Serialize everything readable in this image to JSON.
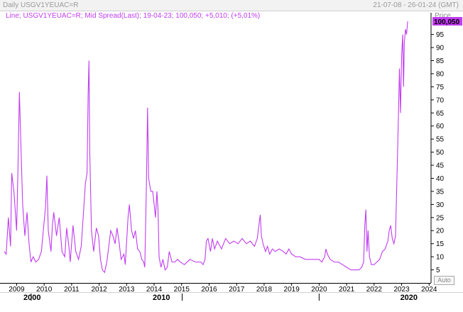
{
  "header": {
    "left_label": "Daily USGV1YEUAC=R",
    "right_label": "21-07-08 - 26-01-24 (GMT)",
    "price_label": "Price"
  },
  "legend": {
    "prefix": "Line; USGV1YEUAC=R; Mid Spread(Last); 19-04-23; 100,050; +5,010; (+5,01%)",
    "text": "Line; USGV1YEUAC=R; Mid Spread(Last); 19-04-23; 100,050; +5,010; (+5,01%)"
  },
  "auto_button": {
    "label": "Auto"
  },
  "last_value_badge": "100,050",
  "colors": {
    "series": "#c03cf0",
    "legend_text": "#2a2aa8",
    "badge_bg": "#c03cf0"
  },
  "chart_data": {
    "type": "line",
    "xlabel": "",
    "ylabel": "Price",
    "ylim": [
      0,
      100.05
    ],
    "xlim": [
      2008.55,
      2024.07
    ],
    "year_ticks": [
      "2009",
      "2010",
      "2011",
      "2012",
      "2013",
      "2014",
      "2015",
      "2016",
      "2017",
      "2018",
      "2019",
      "2020",
      "2021",
      "2022",
      "2023",
      "2024"
    ],
    "decade_ticks": [
      "2000",
      "2010",
      "2020"
    ],
    "y_ticks": [
      "5",
      "10",
      "15",
      "20",
      "25",
      "30",
      "35",
      "40",
      "45",
      "50",
      "55",
      "60",
      "65",
      "70",
      "75",
      "80",
      "85",
      "90",
      "95"
    ],
    "series": [
      {
        "points": [
          [
            2008.55,
            12
          ],
          [
            2008.62,
            11
          ],
          [
            2008.7,
            25
          ],
          [
            2008.78,
            14
          ],
          [
            2008.82,
            42
          ],
          [
            2008.9,
            35
          ],
          [
            2009.0,
            20
          ],
          [
            2009.05,
            45
          ],
          [
            2009.1,
            73
          ],
          [
            2009.15,
            55
          ],
          [
            2009.22,
            30
          ],
          [
            2009.3,
            18
          ],
          [
            2009.38,
            27
          ],
          [
            2009.45,
            15
          ],
          [
            2009.52,
            8
          ],
          [
            2009.6,
            10
          ],
          [
            2009.7,
            8
          ],
          [
            2009.8,
            9
          ],
          [
            2009.9,
            12
          ],
          [
            2009.96,
            19
          ],
          [
            2010.05,
            29
          ],
          [
            2010.1,
            41
          ],
          [
            2010.15,
            20
          ],
          [
            2010.25,
            12
          ],
          [
            2010.3,
            22
          ],
          [
            2010.35,
            27
          ],
          [
            2010.45,
            18
          ],
          [
            2010.55,
            25
          ],
          [
            2010.65,
            12
          ],
          [
            2010.75,
            10
          ],
          [
            2010.82,
            21
          ],
          [
            2010.9,
            14
          ],
          [
            2010.95,
            8
          ],
          [
            2011.05,
            22
          ],
          [
            2011.15,
            12
          ],
          [
            2011.25,
            9
          ],
          [
            2011.35,
            14
          ],
          [
            2011.45,
            30
          ],
          [
            2011.5,
            38
          ],
          [
            2011.56,
            42
          ],
          [
            2011.6,
            72
          ],
          [
            2011.63,
            85
          ],
          [
            2011.66,
            50
          ],
          [
            2011.72,
            20
          ],
          [
            2011.8,
            12
          ],
          [
            2011.9,
            21
          ],
          [
            2011.98,
            18
          ],
          [
            2012.05,
            9
          ],
          [
            2012.12,
            5
          ],
          [
            2012.2,
            4
          ],
          [
            2012.28,
            8
          ],
          [
            2012.35,
            14
          ],
          [
            2012.42,
            20
          ],
          [
            2012.5,
            18
          ],
          [
            2012.58,
            15
          ],
          [
            2012.65,
            21
          ],
          [
            2012.72,
            16
          ],
          [
            2012.8,
            9
          ],
          [
            2012.9,
            11
          ],
          [
            2012.95,
            7
          ],
          [
            2013.05,
            25
          ],
          [
            2013.1,
            30
          ],
          [
            2013.18,
            20
          ],
          [
            2013.25,
            17
          ],
          [
            2013.32,
            20
          ],
          [
            2013.4,
            13
          ],
          [
            2013.48,
            12
          ],
          [
            2013.55,
            9
          ],
          [
            2013.62,
            8
          ],
          [
            2013.66,
            6
          ],
          [
            2013.72,
            38
          ],
          [
            2013.76,
            67
          ],
          [
            2013.8,
            40
          ],
          [
            2013.88,
            35
          ],
          [
            2013.95,
            35
          ],
          [
            2014.05,
            25
          ],
          [
            2014.1,
            35
          ],
          [
            2014.14,
            28
          ],
          [
            2014.18,
            10
          ],
          [
            2014.25,
            6
          ],
          [
            2014.32,
            9
          ],
          [
            2014.4,
            5
          ],
          [
            2014.48,
            6
          ],
          [
            2014.55,
            12
          ],
          [
            2014.65,
            8
          ],
          [
            2014.75,
            8
          ],
          [
            2014.85,
            9
          ],
          [
            2014.95,
            8
          ],
          [
            2015.1,
            7
          ],
          [
            2015.3,
            9
          ],
          [
            2015.5,
            8
          ],
          [
            2015.7,
            8
          ],
          [
            2015.78,
            7
          ],
          [
            2015.85,
            9
          ],
          [
            2015.9,
            16
          ],
          [
            2015.96,
            17
          ],
          [
            2016.05,
            12
          ],
          [
            2016.12,
            17
          ],
          [
            2016.2,
            13
          ],
          [
            2016.3,
            16
          ],
          [
            2016.45,
            13
          ],
          [
            2016.6,
            17
          ],
          [
            2016.75,
            15
          ],
          [
            2016.9,
            16
          ],
          [
            2017.05,
            15
          ],
          [
            2017.2,
            17
          ],
          [
            2017.35,
            15
          ],
          [
            2017.5,
            16
          ],
          [
            2017.65,
            14
          ],
          [
            2017.75,
            17
          ],
          [
            2017.82,
            23
          ],
          [
            2017.86,
            26
          ],
          [
            2017.9,
            18
          ],
          [
            2017.96,
            15
          ],
          [
            2018.05,
            12
          ],
          [
            2018.12,
            14
          ],
          [
            2018.2,
            11
          ],
          [
            2018.3,
            13
          ],
          [
            2018.4,
            12
          ],
          [
            2018.55,
            13
          ],
          [
            2018.7,
            12
          ],
          [
            2018.8,
            11
          ],
          [
            2018.9,
            13
          ],
          [
            2019.0,
            11
          ],
          [
            2019.15,
            10
          ],
          [
            2019.3,
            10
          ],
          [
            2019.5,
            9
          ],
          [
            2019.7,
            9
          ],
          [
            2019.85,
            9
          ],
          [
            2020.0,
            9
          ],
          [
            2020.1,
            8
          ],
          [
            2020.2,
            10
          ],
          [
            2020.25,
            13
          ],
          [
            2020.3,
            11
          ],
          [
            2020.4,
            9
          ],
          [
            2020.55,
            8
          ],
          [
            2020.7,
            8
          ],
          [
            2020.85,
            7
          ],
          [
            2021.0,
            6
          ],
          [
            2021.15,
            5
          ],
          [
            2021.3,
            5
          ],
          [
            2021.45,
            5
          ],
          [
            2021.55,
            6
          ],
          [
            2021.62,
            8
          ],
          [
            2021.66,
            22
          ],
          [
            2021.7,
            28
          ],
          [
            2021.74,
            12
          ],
          [
            2021.78,
            20
          ],
          [
            2021.83,
            10
          ],
          [
            2021.9,
            7
          ],
          [
            2022.0,
            7
          ],
          [
            2022.1,
            8
          ],
          [
            2022.2,
            9
          ],
          [
            2022.3,
            12
          ],
          [
            2022.4,
            13
          ],
          [
            2022.5,
            16
          ],
          [
            2022.55,
            20
          ],
          [
            2022.6,
            22
          ],
          [
            2022.66,
            17
          ],
          [
            2022.72,
            15
          ],
          [
            2022.78,
            18
          ],
          [
            2022.84,
            45
          ],
          [
            2022.88,
            62
          ],
          [
            2022.92,
            82
          ],
          [
            2022.96,
            65
          ],
          [
            2023.0,
            87
          ],
          [
            2023.04,
            95
          ],
          [
            2023.07,
            75
          ],
          [
            2023.1,
            92
          ],
          [
            2023.14,
            97
          ],
          [
            2023.18,
            95
          ],
          [
            2023.22,
            100.05
          ]
        ]
      }
    ],
    "last_value": 100.05
  }
}
